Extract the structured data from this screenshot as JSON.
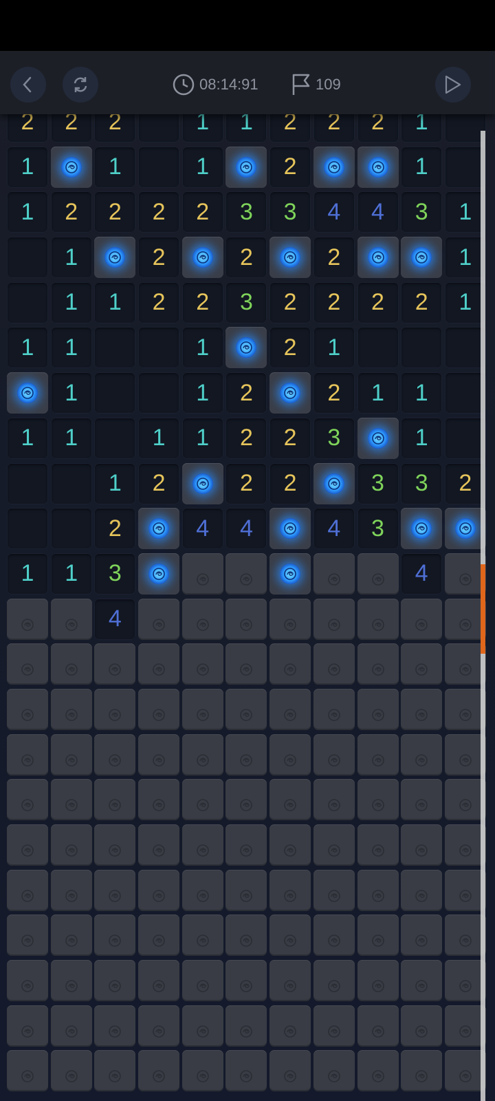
{
  "toolbar": {
    "timer": "08:14:91",
    "flags": "109",
    "icons": [
      "back-icon",
      "restart-icon",
      "clock-icon",
      "flag-icon",
      "play-icon"
    ]
  },
  "colors": {
    "n1": "#4fd0c9",
    "n2": "#e6c45b",
    "n3": "#7fd35a",
    "n4": "#4f6fd6",
    "mine_glow": "#2e9cff",
    "scroll_thumb": "#e0661c"
  },
  "board": {
    "columns": 11,
    "rows": [
      "222_112221_",
      "1M1_1M2MM1_",
      "12222334431",
      "_1M2M2M2MM1",
      "_1122322221",
      "11__1M21___",
      "M1__12M211_",
      "11_11223M1_",
      "__12M22M332",
      "__2M44M43MM",
      "113M##M##4#",
      "##4########",
      "###########",
      "###########",
      "###########",
      "###########",
      "###########",
      "###########",
      "###########",
      "###########",
      "###########",
      "###########"
    ]
  }
}
